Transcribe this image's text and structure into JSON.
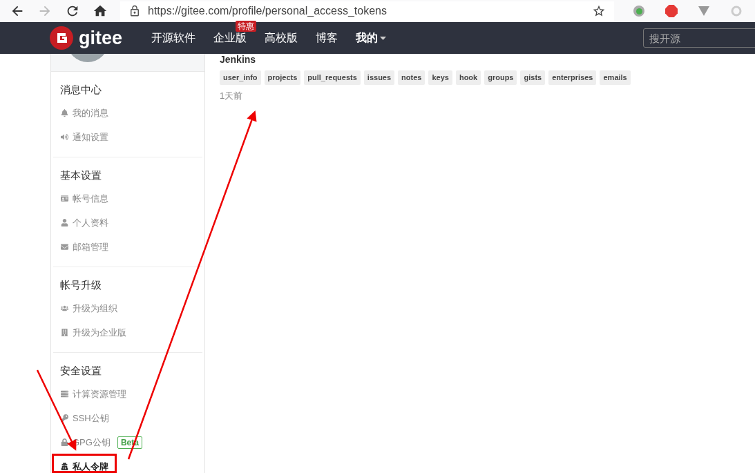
{
  "browser": {
    "url": "https://gitee.com/profile/personal_access_tokens",
    "forward_disabled": true
  },
  "navbar": {
    "logo_text": "gitee",
    "items": [
      {
        "label": "开源软件"
      },
      {
        "label": "企业版",
        "badge": "特惠"
      },
      {
        "label": "高校版"
      },
      {
        "label": "博客"
      }
    ],
    "user_menu": "我的",
    "search": {
      "placeholder": "搜开源"
    }
  },
  "sidebar": {
    "sections": [
      {
        "title": "消息中心",
        "items": [
          {
            "label": "我的消息",
            "selected": false
          },
          {
            "label": "通知设置",
            "selected": false
          }
        ]
      },
      {
        "title": "基本设置",
        "items": [
          {
            "label": "帐号信息",
            "selected": false
          },
          {
            "label": "个人资料",
            "selected": false
          },
          {
            "label": "邮箱管理",
            "selected": false
          }
        ]
      },
      {
        "title": "帐号升级",
        "items": [
          {
            "label": "升级为组织",
            "selected": false
          },
          {
            "label": "升级为企业版",
            "selected": false
          }
        ]
      },
      {
        "title": "安全设置",
        "items": [
          {
            "label": "计算资源管理",
            "selected": false
          },
          {
            "label": "SSH公钥",
            "selected": false
          },
          {
            "label": "GPG公钥",
            "selected": false,
            "badge": "Beta"
          },
          {
            "label": "私人令牌",
            "selected": true
          }
        ]
      }
    ]
  },
  "token": {
    "name": "Jenkins",
    "scopes": [
      "user_info",
      "projects",
      "pull_requests",
      "issues",
      "notes",
      "keys",
      "hook",
      "groups",
      "gists",
      "enterprises",
      "emails"
    ],
    "time": "1天前"
  }
}
